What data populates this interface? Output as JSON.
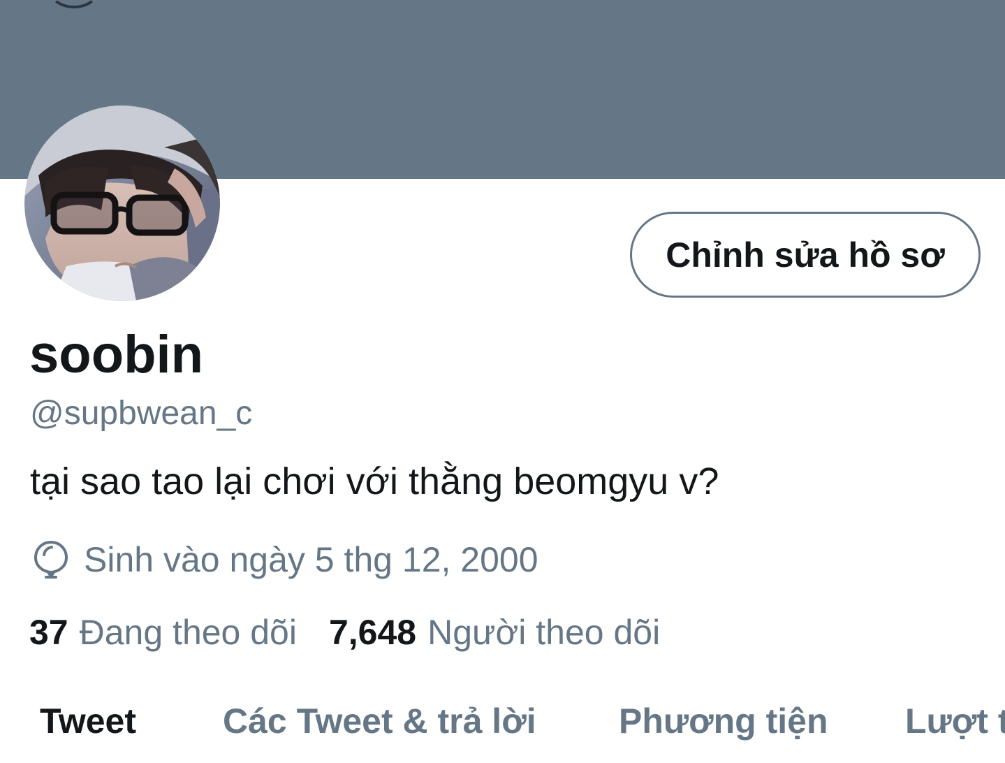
{
  "profile": {
    "display_name": "soobin",
    "handle": "@supbwean_c",
    "bio": "tại sao tao lại chơi với thằng beomgyu v?",
    "birth_date": "Sinh vào ngày 5 thg 12, 2000",
    "birth_icon": "balloon-icon"
  },
  "actions": {
    "edit_profile_label": "Chỉnh sửa hồ sơ"
  },
  "stats": {
    "following_count": "37",
    "following_label": "Đang theo dõi",
    "followers_count": "7,648",
    "followers_label": "Người theo dõi"
  },
  "tabs": [
    {
      "label": "Tweet",
      "active": true
    },
    {
      "label": "Các Tweet & trả lời",
      "active": false
    },
    {
      "label": "Phương tiện",
      "active": false
    },
    {
      "label": "Lượt t",
      "active": false
    }
  ],
  "colors": {
    "banner": "#657786",
    "primary_text": "#14171a",
    "secondary_text": "#657786",
    "background": "#ffffff"
  }
}
